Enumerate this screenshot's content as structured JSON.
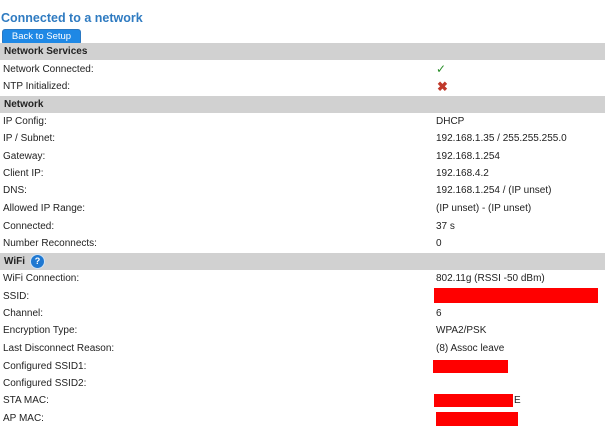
{
  "title": "Connected to a network",
  "back_button": "Back to Setup",
  "sections": {
    "network_services": "Network Services",
    "network": "Network",
    "wifi": "WiFi"
  },
  "help_icon": "?",
  "network_services": {
    "network_connected": {
      "label": "Network Connected:",
      "status": "check"
    },
    "ntp_initialized": {
      "label": "NTP Initialized:",
      "status": "cross"
    }
  },
  "network": {
    "ip_config": {
      "label": "IP Config:",
      "value": "DHCP"
    },
    "ip_subnet": {
      "label": "IP / Subnet:",
      "value": "192.168.1.35 / 255.255.255.0"
    },
    "gateway": {
      "label": "Gateway:",
      "value": "192.168.1.254"
    },
    "client_ip": {
      "label": "Client IP:",
      "value": "192.168.4.2"
    },
    "dns": {
      "label": "DNS:",
      "value": "192.168.1.254 / (IP unset)"
    },
    "allowed_ip_range": {
      "label": "Allowed IP Range:",
      "value": "(IP unset) - (IP unset)"
    },
    "connected": {
      "label": "Connected:",
      "value": "37 s"
    },
    "number_reconnects": {
      "label": "Number Reconnects:",
      "value": "0"
    }
  },
  "wifi": {
    "wifi_connection": {
      "label": "WiFi Connection:",
      "value": "802.11g (RSSI -50 dBm)"
    },
    "ssid": {
      "label": "SSID:"
    },
    "channel": {
      "label": "Channel:",
      "value": "6"
    },
    "encryption_type": {
      "label": "Encryption Type:",
      "value": "WPA2/PSK"
    },
    "last_disconnect_reason": {
      "label": "Last Disconnect Reason:",
      "value": "(8) Assoc leave"
    },
    "configured_ssid1": {
      "label": "Configured SSID1:"
    },
    "configured_ssid2": {
      "label": "Configured SSID2:"
    },
    "sta_mac": {
      "label": "STA MAC:",
      "trailing": "E"
    },
    "ap_mac": {
      "label": "AP MAC:"
    }
  },
  "colors": {
    "title": "#2f7bc1",
    "button": "#1e88e5",
    "section_header": "#d1d1d1",
    "check": "#2a8f2a",
    "cross": "#c0392b",
    "redaction": "#ff0000"
  }
}
